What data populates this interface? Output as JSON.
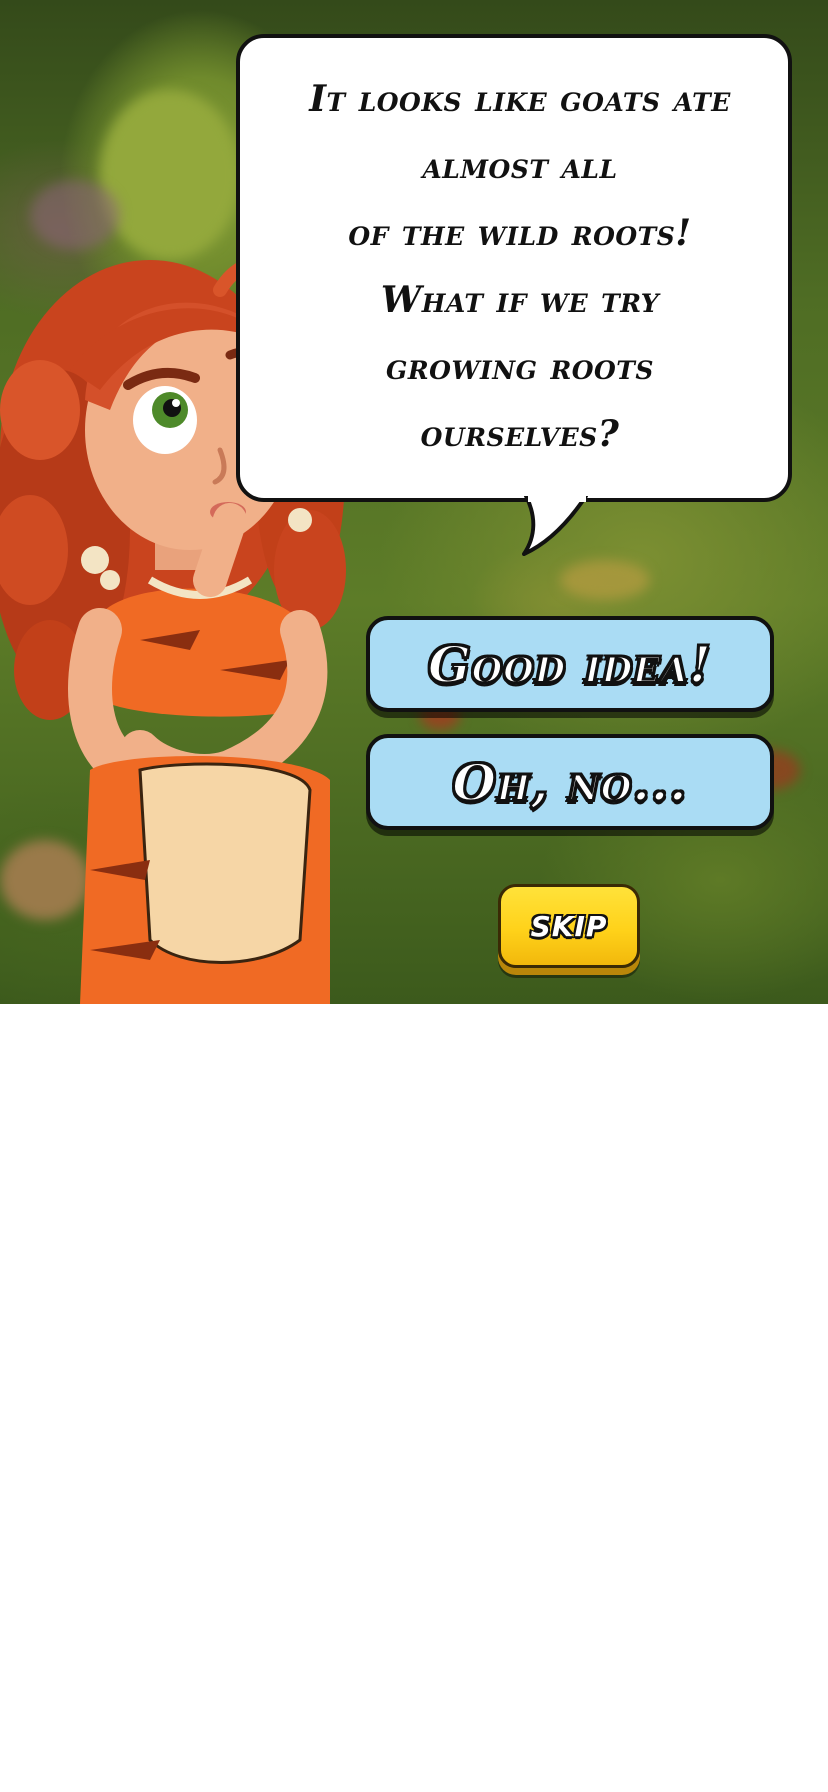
{
  "dialog": {
    "lines": [
      "It looks like goats ate",
      "almost all",
      "of the wild roots!",
      "What if we try",
      "growing roots",
      "ourselves?"
    ]
  },
  "choices": [
    {
      "label": "Good idea!"
    },
    {
      "label": "Oh, no..."
    }
  ],
  "skip": {
    "label": "SKIP"
  },
  "colors": {
    "bubble_bg": "#ffffff",
    "choice_bg": "#aadcf4",
    "skip_bg": "#ffd21a",
    "scene_green": "#5d7c28"
  },
  "icons": {
    "character": "cavewoman-character-thinking"
  }
}
